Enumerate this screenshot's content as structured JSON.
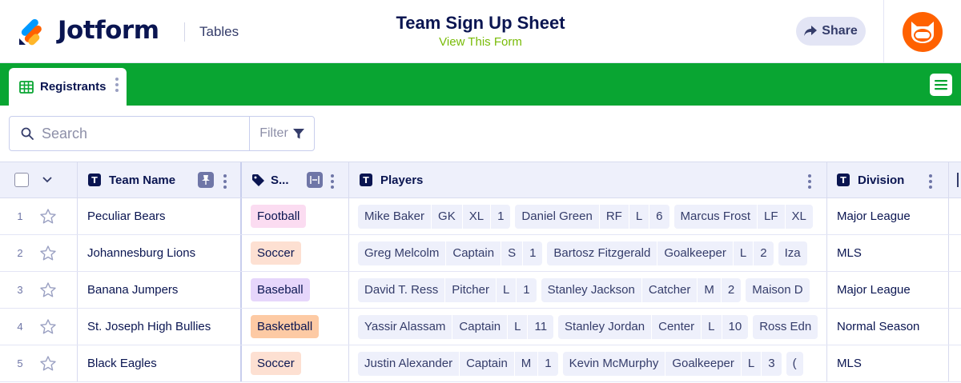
{
  "header": {
    "brand": "Jotform",
    "product": "Tables",
    "form_title": "Team Sign Up Sheet",
    "form_link": "View This Form",
    "share_label": "Share"
  },
  "tabs": [
    {
      "label": "Registrants",
      "icon": "grid-table-icon",
      "active": true
    }
  ],
  "toolbar": {
    "search_placeholder": "Search",
    "filter_label": "Filter"
  },
  "colors": {
    "accent_green": "#09a532",
    "avatar_orange": "#ff6100",
    "link_green": "#78bb07",
    "badge_football": "#fbdcf1",
    "badge_soccer": "#fde0d2",
    "badge_baseball": "#e6d6fb",
    "badge_basketball": "#fdcaa4"
  },
  "columns": {
    "team_name": "Team Name",
    "sport": "S...",
    "players": "Players",
    "division": "Division"
  },
  "rows": [
    {
      "num": "1",
      "team": "Peculiar Bears",
      "sport": "Football",
      "sport_color": "#fbdcf1",
      "players": [
        [
          "Mike Baker",
          "GK",
          "XL",
          "1"
        ],
        [
          "Daniel Green",
          "RF",
          "L",
          "6"
        ],
        [
          "Marcus Frost",
          "LF",
          "XL"
        ]
      ],
      "division": "Major League"
    },
    {
      "num": "2",
      "team": "Johannesburg Lions",
      "sport": "Soccer",
      "sport_color": "#fde0d2",
      "players": [
        [
          "Greg Melcolm",
          "Captain",
          "S",
          "1"
        ],
        [
          "Bartosz Fitzgerald",
          "Goalkeeper",
          "L",
          "2"
        ],
        [
          "Iza"
        ]
      ],
      "division": "MLS"
    },
    {
      "num": "3",
      "team": "Banana Jumpers",
      "sport": "Baseball",
      "sport_color": "#e6d6fb",
      "players": [
        [
          "David T. Ress",
          "Pitcher",
          "L",
          "1"
        ],
        [
          "Stanley Jackson",
          "Catcher",
          "M",
          "2"
        ],
        [
          "Maison D"
        ]
      ],
      "division": "Major League"
    },
    {
      "num": "4",
      "team": "St. Joseph High Bullies",
      "sport": "Basketball",
      "sport_color": "#fdcaa4",
      "players": [
        [
          "Yassir Alassam",
          "Captain",
          "L",
          "11"
        ],
        [
          "Stanley Jordan",
          "Center",
          "L",
          "10"
        ],
        [
          "Ross Edn"
        ]
      ],
      "division": "Normal Season"
    },
    {
      "num": "5",
      "team": "Black Eagles",
      "sport": "Soccer",
      "sport_color": "#fde0d2",
      "players": [
        [
          "Justin Alexander",
          "Captain",
          "M",
          "1"
        ],
        [
          "Kevin McMurphy",
          "Goalkeeper",
          "L",
          "3"
        ],
        [
          "("
        ]
      ],
      "division": "MLS"
    }
  ]
}
